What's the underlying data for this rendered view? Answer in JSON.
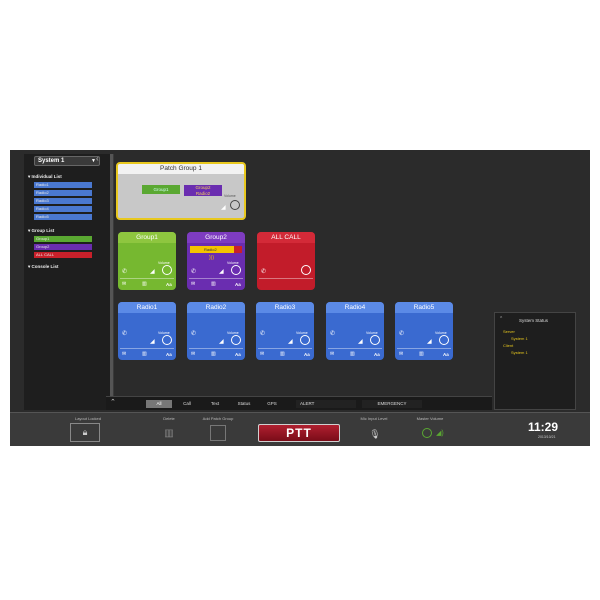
{
  "sidebar": {
    "system_select": "System 1",
    "individual_list_label": "Individual List",
    "individual_items": [
      "Radio1",
      "Radio2",
      "Radio3",
      "Radio4",
      "Radio5"
    ],
    "group_list_label": "Group List",
    "group_items": [
      "Group1",
      "Group2",
      "ALL CALL"
    ],
    "console_list_label": "Console List"
  },
  "patch_group": {
    "title": "Patch Group 1",
    "chip1": "Group1",
    "chip2_line1": "Group2",
    "chip2_line2": "Radio2",
    "volume_label": "Volume"
  },
  "groups": [
    {
      "title": "Group1",
      "color": "#76b830"
    },
    {
      "title": "Group2",
      "color": "#6a2db0",
      "strip": "Radio2"
    },
    {
      "title": "ALL CALL",
      "color": "#c21c2a"
    }
  ],
  "radios": [
    {
      "title": "Radio1"
    },
    {
      "title": "Radio2"
    },
    {
      "title": "Radio3"
    },
    {
      "title": "Radio4"
    },
    {
      "title": "Radio5"
    }
  ],
  "card_labels": {
    "volume": "Volume",
    "size": "Aa"
  },
  "tabs": {
    "all": "All",
    "call": "Call",
    "text": "Text",
    "status": "Status",
    "gps": "GPS",
    "alert": "ALERT",
    "emergency": "EMERGENCY"
  },
  "system_status": {
    "title": "System Status",
    "server": "Server",
    "server_sys": "System 1",
    "client": "Client",
    "client_sys": "System 1"
  },
  "footer": {
    "layout_locked": "Layout Locked",
    "delete": "Delete",
    "add_patch_group": "Add Patch Group",
    "ptt": "PTT",
    "mic_input_level": "Mic Input Level",
    "master_volume": "Master Volume",
    "time": "11:29",
    "date": "2013/10/21"
  },
  "colors": {
    "accent_yellow": "#e8c81e",
    "ptt_red": "#9a1424",
    "radio_blue": "#3a6ad0"
  }
}
